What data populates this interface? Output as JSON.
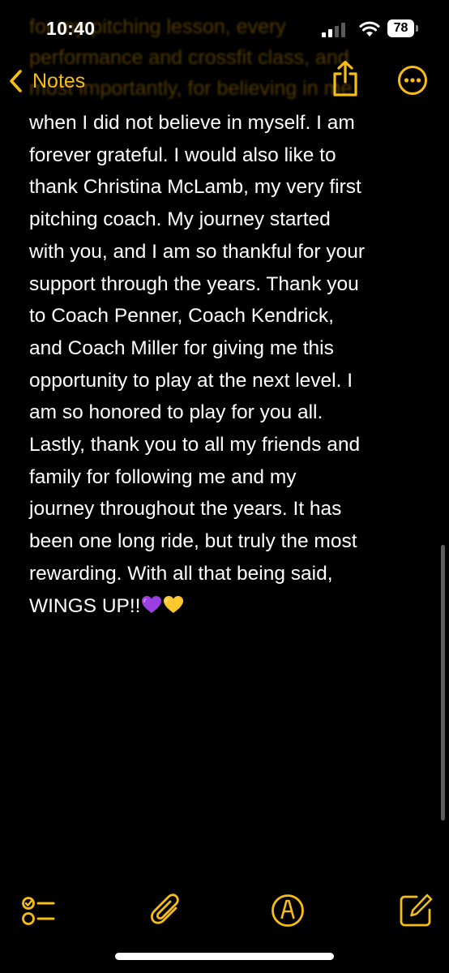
{
  "status_bar": {
    "time": "10:40",
    "battery_level": "78",
    "icons": [
      "signal-icon",
      "wifi-icon",
      "battery-icon"
    ]
  },
  "nav": {
    "back_label": "Notes",
    "icons": [
      "chevron-left-icon",
      "share-icon",
      "more-icon"
    ],
    "accent_color": "#f6bd16"
  },
  "faded_lines": [
    "for my pitching lesson, every",
    "performance and crossfit class, and",
    "most importantly, for believing in me"
  ],
  "note": {
    "lines": [
      "when I did not believe in myself. I am",
      "forever grateful. I would also like to",
      "thank Christina McLamb, my very first",
      "pitching coach. My journey started",
      "with you, and I am so thankful for your",
      "support through the years. Thank you",
      "to Coach Penner, Coach Kendrick,",
      "and Coach Miller for giving me this",
      "opportunity to play at the next level. I",
      "am so honored to play for you all.",
      "Lastly, thank you to all my friends and",
      "family for following me and my",
      "journey throughout the years. It has",
      "been one long ride, but truly the most",
      "rewarding. With all that being said,"
    ],
    "last_line": "WINGS UP!!",
    "emoji": [
      "purple-heart",
      "yellow-heart"
    ]
  },
  "toolbar": {
    "icons": [
      "checklist-icon",
      "paperclip-icon",
      "markup-pen-icon",
      "compose-icon"
    ]
  }
}
